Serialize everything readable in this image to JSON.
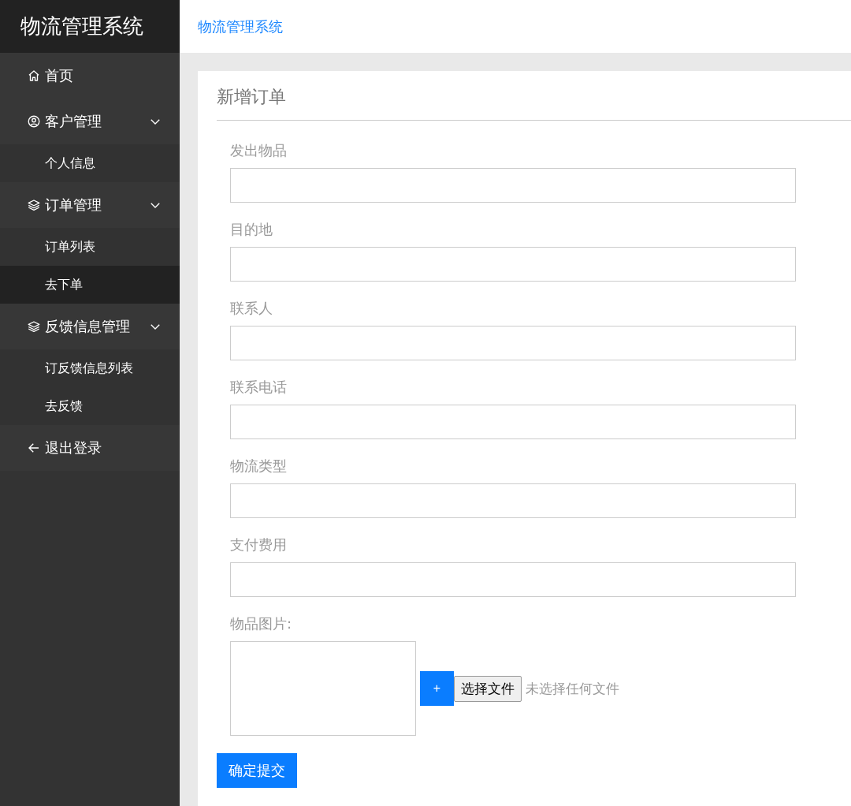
{
  "sidebar": {
    "logo": "物流管理系统",
    "items": [
      {
        "kind": "link",
        "label": "首页",
        "selected": false
      },
      {
        "kind": "group",
        "label": "客户管理",
        "expanded": true,
        "children": [
          {
            "label": "个人信息",
            "selected": false
          }
        ]
      },
      {
        "kind": "group",
        "label": "订单管理",
        "expanded": true,
        "children": [
          {
            "label": "订单列表",
            "selected": false
          },
          {
            "label": "去下单",
            "selected": true
          }
        ]
      },
      {
        "kind": "group",
        "label": "反馈信息管理",
        "expanded": true,
        "children": [
          {
            "label": "订反馈信息列表",
            "selected": false
          },
          {
            "label": "去反馈",
            "selected": false
          }
        ]
      },
      {
        "kind": "logout",
        "label": "退出登录",
        "selected": false
      }
    ]
  },
  "header": {
    "breadcrumb": "物流管理系统"
  },
  "form": {
    "title": "新增订单",
    "fields": [
      {
        "label": "发出物品"
      },
      {
        "label": "目的地"
      },
      {
        "label": "联系人"
      },
      {
        "label": "联系电话"
      },
      {
        "label": "物流类型"
      },
      {
        "label": "支付费用"
      }
    ],
    "upload": {
      "label": "物品图片:",
      "add_button": "+",
      "file_button": "选择文件",
      "file_status": "未选择任何文件"
    },
    "submit": "确定提交"
  }
}
